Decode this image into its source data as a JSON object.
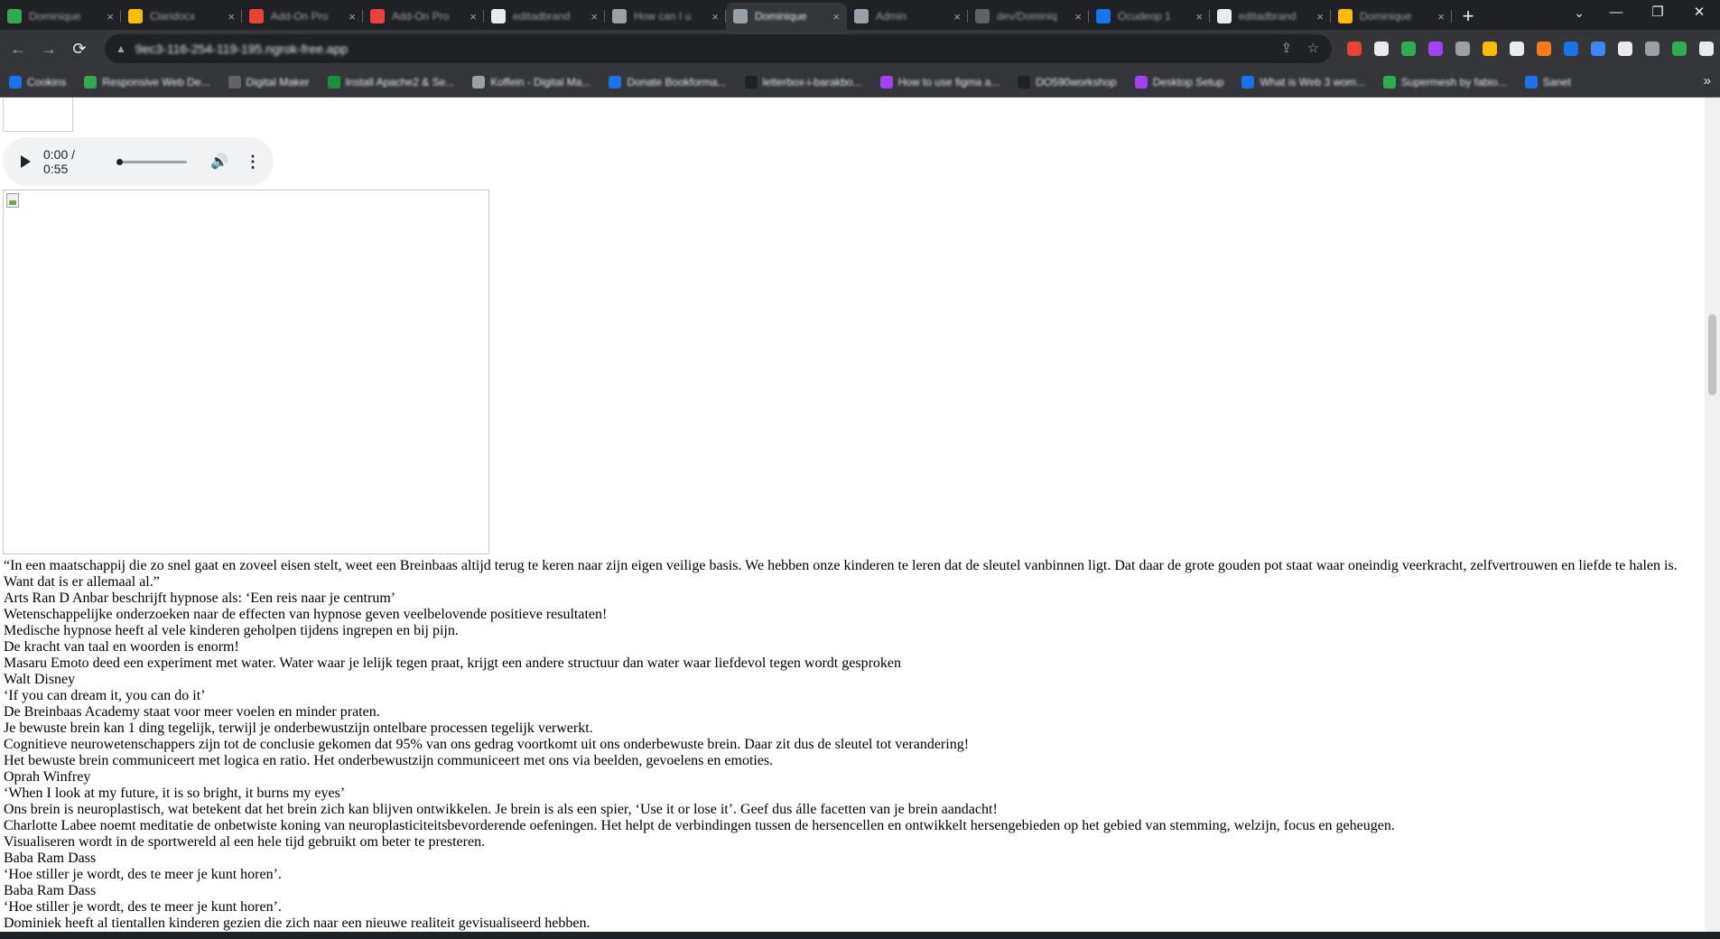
{
  "browser": {
    "tabs": [
      {
        "title": "Dominique",
        "color": "#34a853",
        "active": false
      },
      {
        "title": "Claridocx",
        "color": "#fbbc04",
        "active": false
      },
      {
        "title": "Add-On Pro",
        "color": "#ea4335",
        "active": false
      },
      {
        "title": "Add-On Pro",
        "color": "#ea4335",
        "active": false
      },
      {
        "title": "editadbrand",
        "color": "#e8eaed",
        "active": false
      },
      {
        "title": "How can I u",
        "color": "#9aa0a6",
        "active": false
      },
      {
        "title": "Dominique",
        "color": "#9aa0a6",
        "active": true
      },
      {
        "title": "Admin",
        "color": "#9aa0a6",
        "active": false
      },
      {
        "title": "dev/Dominiq",
        "color": "#5f6368",
        "active": false
      },
      {
        "title": "Ocudeop 1",
        "color": "#1a73e8",
        "active": false
      },
      {
        "title": "editadbrand",
        "color": "#e8eaed",
        "active": false
      },
      {
        "title": "Dominique",
        "color": "#fbbc04",
        "active": false
      }
    ],
    "url": "9ec3-116-254-119-195.ngrok-free.app",
    "bookmarks": [
      {
        "title": "Cookins",
        "color": "#1a73e8"
      },
      {
        "title": "Responsive Web De...",
        "color": "#34a853"
      },
      {
        "title": "Digital Maker",
        "color": "#5f6368"
      },
      {
        "title": "Install Apache2 & Se...",
        "color": "#1e8e3e"
      },
      {
        "title": "Koffein - Digital Ma...",
        "color": "#9aa0a6"
      },
      {
        "title": "Donate Bookforma...",
        "color": "#1a73e8"
      },
      {
        "title": "letterbox-i-barakbo...",
        "color": "#202124"
      },
      {
        "title": "How to use figma a...",
        "color": "#a142f4"
      },
      {
        "title": "DO590workshop",
        "color": "#202124"
      },
      {
        "title": "Desktop Setup",
        "color": "#a142f4"
      },
      {
        "title": "What is Web 3 wom...",
        "color": "#1a73e8"
      },
      {
        "title": "Supermesh by fabio...",
        "color": "#34a853"
      },
      {
        "title": "Sanet",
        "color": "#1a73e8"
      }
    ]
  },
  "page": {
    "audio": {
      "time": "0:00 / 0:55"
    },
    "lines": [
      "“In een maatschappij die zo snel gaat en zoveel eisen stelt, weet een Breinbaas altijd terug te keren naar zijn eigen veilige basis. We hebben onze kinderen te leren dat de sleutel vanbinnen ligt. Dat daar de grote gouden pot staat waar oneindig veerkracht, zelfvertrouwen en liefde te halen is. Want dat is er allemaal al.”",
      "Arts Ran D Anbar beschrijft hypnose als: ‘Een reis naar je centrum’",
      "Wetenschappelijke onderzoeken naar de effecten van hypnose geven veelbelovende positieve resultaten!",
      "Medische hypnose heeft al vele kinderen geholpen tijdens ingrepen en bij pijn.",
      "De kracht van taal en woorden is enorm!",
      "Masaru Emoto deed een experiment met water. Water waar je lelijk tegen praat, krijgt een andere structuur dan water waar liefdevol tegen wordt gesproken",
      "Walt Disney",
      "‘If you can dream it, you can do it’",
      "De Breinbaas Academy staat voor meer voelen en minder praten.",
      "Je bewuste brein kan 1 ding tegelijk, terwijl je onderbewustzijn ontelbare processen tegelijk verwerkt.",
      "Cognitieve neurowetenschappers zijn tot de conclusie gekomen dat 95% van ons gedrag voortkomt uit ons onderbewuste brein. Daar zit dus de sleutel tot verandering!",
      "Het bewuste brein communiceert met logica en ratio. Het onderbewustzijn communiceert met ons via beelden, gevoelens en emoties.",
      "Oprah Winfrey",
      "‘When I look at my future, it is so bright, it burns my eyes’",
      "Ons brein is neuroplastisch, wat betekent dat het brein zich kan blijven ontwikkelen. Je brein is als een spier, ‘Use it or lose it’. Geef dus álle facetten van je brein aandacht!",
      "Charlotte Labee noemt meditatie de onbetwiste koning van neuroplasticiteitsbevorderende oefeningen. Het helpt de verbindingen tussen de hersencellen en ontwikkelt hersengebieden op het gebied van stemming, welzijn, focus en geheugen.",
      "Visualiseren wordt in de sportwereld al een hele tijd gebruikt om beter te presteren.",
      "Baba Ram Dass",
      "‘Hoe stiller je wordt, des te meer je kunt horen’.",
      "Baba Ram Dass",
      "‘Hoe stiller je wordt, des te meer je kunt horen’.",
      "Dominiek heeft al tientallen kinderen gezien die zich naar een nieuwe realiteit gevisualiseerd hebben."
    ]
  },
  "icons": {
    "back": "←",
    "forward": "→",
    "reload": "⟳",
    "lock": "▲",
    "share": "⇪",
    "star": "☆",
    "newtab": "+",
    "tabsearch": "⌄",
    "minimize": "—",
    "restore": "❐",
    "close": "✕",
    "kebab": "⋮",
    "more": "»",
    "volume": "🔊",
    "audio_more": "⋮",
    "tab_close": "×"
  },
  "extensions": [
    "#ea4335",
    "#e8eaed",
    "#34a853",
    "#a142f4",
    "#9aa0a6",
    "#fbbc04",
    "#e8eaed",
    "#fa7b17",
    "#1a73e8",
    "#4285f4",
    "#e8eaed",
    "#9aa0a6",
    "#34a853",
    "#e8eaed"
  ]
}
